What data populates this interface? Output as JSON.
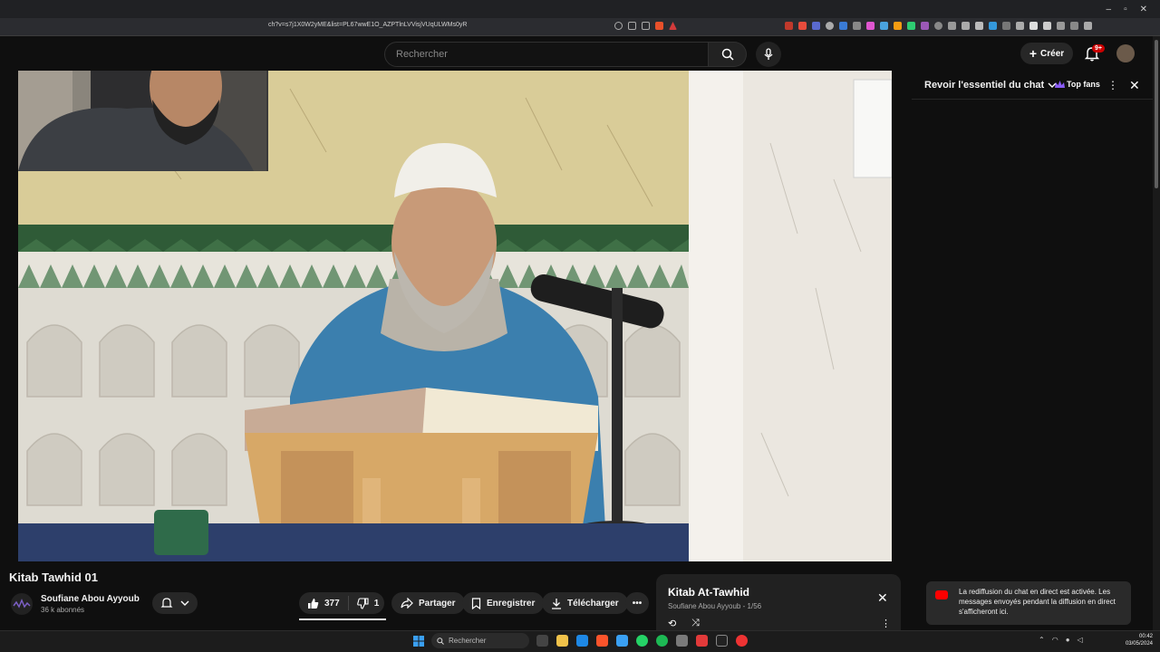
{
  "browser": {
    "url": "ch?v=s7j1X0W2yME&list=PL67wwE1O_AZPTlnLVVisjVUqULWMs0yR",
    "window_controls": [
      "–",
      "▫",
      "✕"
    ]
  },
  "masthead": {
    "search_placeholder": "Rechercher",
    "create_label": "Créer",
    "notif_badge": "9+"
  },
  "chat": {
    "title": "Revoir l'essentiel du chat",
    "top_fans": "Top fans",
    "toast": "La rediffusion du chat en direct est activée. Les messages envoyés pendant la diffusion en direct s'afficheront ici."
  },
  "video": {
    "title": "Kitab Tawhid 01",
    "channel": "Soufiane Abou Ayyoub",
    "subscribers": "36 k abonnés",
    "likes": "377",
    "dislikes": "1",
    "share_label": "Partager",
    "save_label": "Enregistrer",
    "download_label": "Télécharger"
  },
  "playlist": {
    "title": "Kitab At-Tawhid",
    "channel": "Soufiane Abou Ayyoub",
    "separator": "-",
    "position": "1/56"
  },
  "taskbar": {
    "search_placeholder": "Rechercher",
    "time": "00:42",
    "date": "03/05/2024"
  },
  "colors": {
    "background": "#0f0f0f",
    "accent_red": "#ff0000",
    "pill_bg": "#272727"
  }
}
